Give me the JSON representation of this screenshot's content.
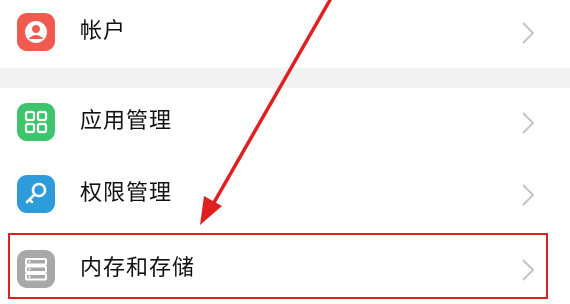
{
  "settings": {
    "items": [
      {
        "label": "帐户",
        "icon": "account-icon"
      },
      {
        "label": "应用管理",
        "icon": "app-grid-icon"
      },
      {
        "label": "权限管理",
        "icon": "key-icon"
      },
      {
        "label": "内存和存储",
        "icon": "storage-icon"
      }
    ]
  },
  "colors": {
    "account_icon": "#f05a4f",
    "apps_icon": "#3ec46d",
    "perm_icon": "#2d9cdb",
    "storage_icon": "#a8a8a8",
    "highlight": "#e02020",
    "chevron": "#c4c4c4"
  }
}
